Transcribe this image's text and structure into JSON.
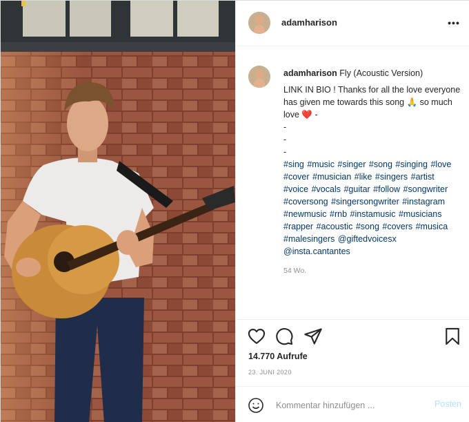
{
  "post": {
    "username": "adamharison",
    "more_label": "•••"
  },
  "caption": {
    "username": "adamharison",
    "title": "Fly (Acoustic Version)",
    "body": "LINK IN BIO ! Thanks for all the love everyone has given me towards this song 🙏 so much love ❤️ -",
    "dashes": [
      "-",
      "-",
      "-"
    ],
    "hashtags": "#sing #music #singer #song #singing #love #cover #musician #like #singers #artist #voice #vocals #guitar #follow #songwriter #coversong #singersongwriter #instagram #newmusic #rnb #instamusic #musicians #rapper #acoustic #song #covers #musica #malesingers @giftedvoicesx @insta.cantantes",
    "time_ago": "54 Wo."
  },
  "stats": {
    "views": "14.770 Aufrufe",
    "date": "23. JUNI 2020"
  },
  "comment_box": {
    "placeholder": "Kommentar hinzufügen ...",
    "post_label": "Posten"
  },
  "icons": {
    "like": "heart-icon",
    "comment": "comment-icon",
    "share": "share-icon",
    "save": "bookmark-icon",
    "emoji": "emoji-icon",
    "more": "more-options-icon"
  },
  "colors": {
    "link": "#00376b",
    "post_button_disabled": "#b2dffc",
    "muted": "#8e8e8e",
    "brick": "#8a4a35"
  }
}
